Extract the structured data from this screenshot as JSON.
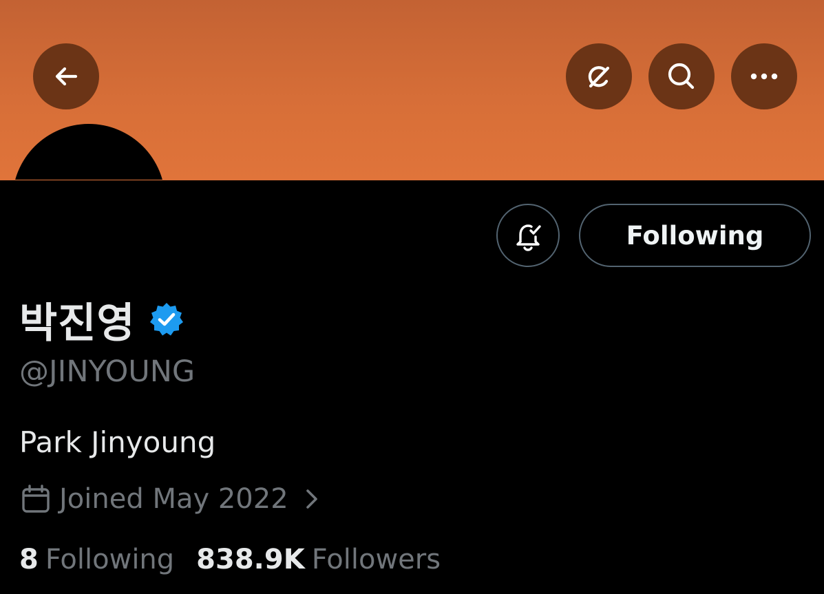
{
  "header": {
    "back_icon": "arrow-left-icon",
    "grok_icon": "grok-slash-circle-icon",
    "search_icon": "search-icon",
    "more_icon": "more-dots-icon"
  },
  "actions": {
    "notify_icon": "bell-check-icon",
    "following_label": "Following"
  },
  "profile": {
    "display_name": "박진영",
    "verified_icon": "verified-badge-icon",
    "handle": "@JINYOUNG",
    "bio": "Park Jinyoung",
    "joined": "Joined May 2022"
  },
  "stats": {
    "following_count": "8",
    "following_label": "Following",
    "followers_count": "838.9K",
    "followers_label": "Followers"
  },
  "colors": {
    "banner": "#d86f38",
    "button_bg": "#6b3416",
    "verified_blue": "#1d9bf0",
    "muted_text": "#71767b"
  }
}
